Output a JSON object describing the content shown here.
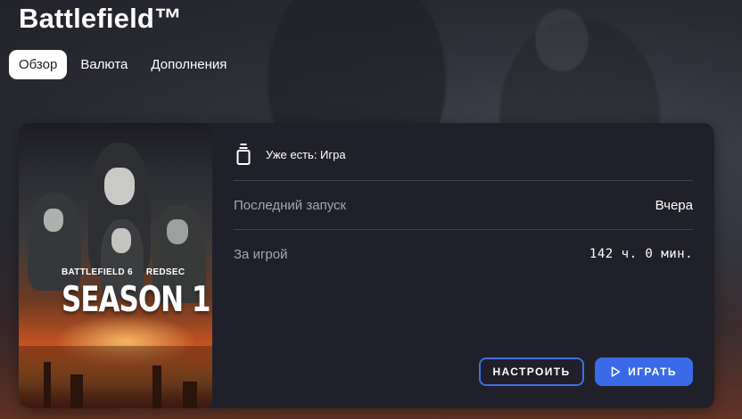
{
  "game": {
    "title": "Battlefield™"
  },
  "tabs": [
    {
      "label": "Обзор",
      "active": true
    },
    {
      "label": "Валюта",
      "active": false
    },
    {
      "label": "Дополнения",
      "active": false
    }
  ],
  "cover": {
    "line1": "BATTLEFIELD 6",
    "line1b": "REDSEC",
    "line2": "SEASON 1"
  },
  "info": {
    "owned_label": "Уже есть: Игра",
    "last_launch_label": "Последний запуск",
    "last_launch_value": "Вчера",
    "playtime_label": "За игрой",
    "playtime_value": "142 ч. 0 мин."
  },
  "buttons": {
    "setup": "НАСТРОИТЬ",
    "play": "ИГРАТЬ"
  },
  "colors": {
    "accent": "#3a6ae8",
    "card": "#1f2029"
  },
  "icons": {
    "owned": "bottle-icon",
    "play": "play-icon"
  }
}
